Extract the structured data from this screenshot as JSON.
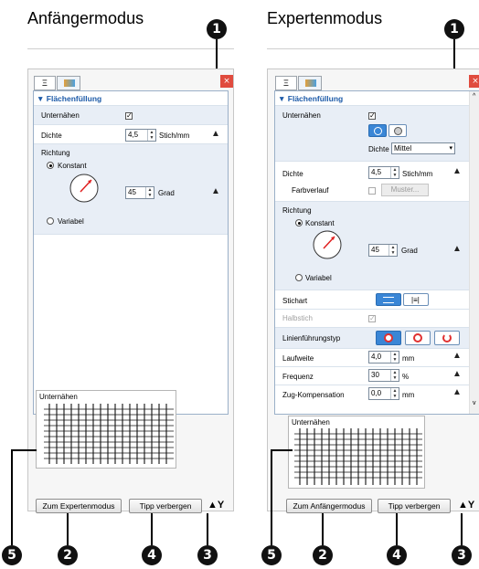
{
  "left": {
    "mode_title": "Anfängermodus",
    "section_title": "▼ Flächenfüllung",
    "rows": {
      "unternahen": "Unternähen",
      "dichte": "Dichte",
      "dichte_value": "4,5",
      "dichte_unit": "Stich/mm",
      "richtung": "Richtung",
      "konstant": "Konstant",
      "angle_value": "45",
      "angle_unit": "Grad",
      "variabel": "Variabel"
    },
    "preview_label": "Unternähen",
    "buttons": {
      "mode_switch": "Zum Expertenmodus",
      "hide_tip": "Tipp verbergen"
    }
  },
  "right": {
    "mode_title": "Expertenmodus",
    "section_title": "▼ Flächenfüllung",
    "rows": {
      "unternahen": "Unternähen",
      "dichte_sub": "Dichte",
      "dichte_dropdown": "Mittel",
      "dichte": "Dichte",
      "dichte_value": "4,5",
      "dichte_unit": "Stich/mm",
      "farbverlauf": "Farbverlauf",
      "muster": "Muster...",
      "richtung": "Richtung",
      "konstant": "Konstant",
      "angle_value": "45",
      "angle_unit": "Grad",
      "variabel": "Variabel",
      "stichart": "Stichart",
      "halbstich": "Halbstich",
      "linienfuhrungstyp": "Linienführungstyp",
      "laufweite": "Laufweite",
      "laufweite_value": "4,0",
      "laufweite_unit": "mm",
      "frequenz": "Frequenz",
      "frequenz_value": "30",
      "frequenz_unit": "%",
      "zug": "Zug-Kompensation",
      "zug_value": "0,0",
      "zug_unit": "mm"
    },
    "preview_label": "Unternähen",
    "buttons": {
      "mode_switch": "Zum Anfängermodus",
      "hide_tip": "Tipp verbergen"
    }
  },
  "callouts": {
    "one": "❶",
    "two": "❷",
    "three": "❸",
    "four": "❹",
    "five": "❺"
  },
  "icons": {
    "close": "×",
    "house": "▲",
    "checkmark": "✓"
  },
  "colors": {
    "accent_blue": "#3a86d6",
    "section_title": "#1c5aa8",
    "close_red": "#e04b3e"
  }
}
